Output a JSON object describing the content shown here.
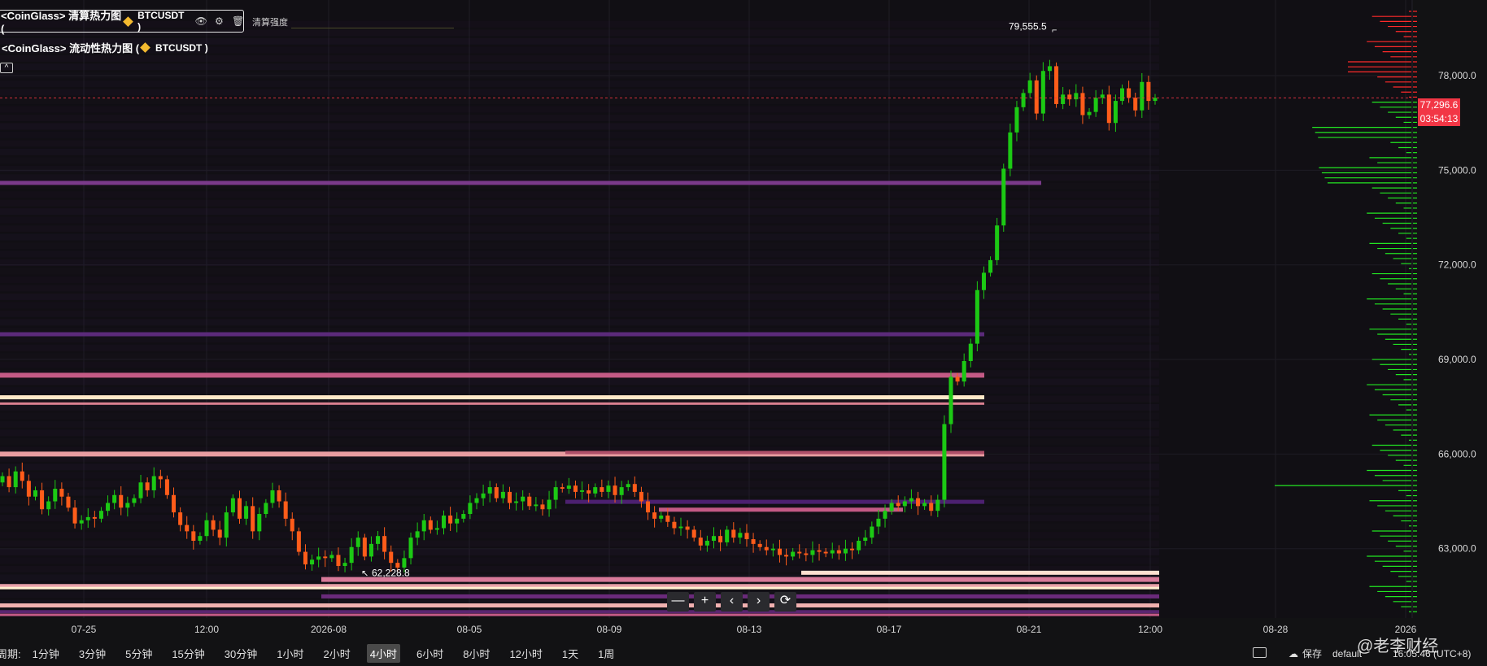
{
  "indicators": {
    "liquidation": {
      "title": "<CoinGlass> 清算热力图 (",
      "symbol": "BTCUSDT )",
      "intensity_label": "清算强度"
    },
    "liquidity": {
      "title": "<CoinGlass> 流动性热力图 (",
      "symbol": "BTCUSDT )"
    },
    "collapse_glyph": "^"
  },
  "nav": {
    "zoom_out": "—",
    "zoom_in": "+",
    "scroll_left": "‹",
    "scroll_right": "›",
    "reset": "⟳"
  },
  "timeframe": {
    "label": "周期:",
    "options": [
      "1分钟",
      "3分钟",
      "5分钟",
      "15分钟",
      "30分钟",
      "1小时",
      "2小时",
      "4小时",
      "6小时",
      "8小时",
      "12小时",
      "1天",
      "1周"
    ],
    "active": "4小时"
  },
  "footer": {
    "save_label": "保存",
    "layout_name": "default",
    "clock": "16:05:46 (UTC+8)",
    "watermark": "@老李财经"
  },
  "price_tags": {
    "last_price": "77,296.6",
    "countdown": "03:54:13"
  },
  "colors": {
    "bull": "#1cc914",
    "bear": "#ff5c1a",
    "last_price": "#f23645",
    "heat_low": "#5a2670",
    "heat_mid": "#c45a86",
    "heat_high": "#fff2c8"
  },
  "chart_data": {
    "type": "candlestick",
    "instrument": "BTCUSDT",
    "interval": "4h",
    "y_axis": {
      "min": 60800,
      "max": 80400,
      "ticks": [
        63000,
        66000,
        69000,
        72000,
        75000,
        78000
      ],
      "tick_labels": [
        "63,000.0",
        "66,000.0",
        "69,000.0",
        "72,000.0",
        "75,000.0",
        "78,000.0"
      ]
    },
    "x_axis": {
      "ticks": [
        "07-25",
        "12:00",
        "2026-08",
        "08-05",
        "08-09",
        "08-13",
        "08-17",
        "08-21",
        "12:00",
        "08-28",
        "2026"
      ]
    },
    "annotations": {
      "high_label": "79,555.5",
      "high_value": 79555.5,
      "low_label": "62,228.8",
      "low_value": 62228.8
    },
    "last_price": 77296.6,
    "closes": [
      65300,
      64950,
      65450,
      65150,
      64650,
      64850,
      64250,
      64500,
      64900,
      64650,
      64300,
      63800,
      63900,
      64000,
      63950,
      64200,
      64450,
      64700,
      64300,
      64450,
      64600,
      65100,
      64850,
      65300,
      65200,
      64700,
      64150,
      63750,
      63550,
      63250,
      63400,
      63900,
      63600,
      63350,
      64150,
      64600,
      63950,
      64350,
      63550,
      64100,
      64450,
      64850,
      64500,
      63950,
      63550,
      62900,
      62500,
      62650,
      62750,
      62700,
      62800,
      62450,
      62550,
      63050,
      63350,
      62750,
      63150,
      63400,
      62900,
      62550,
      62400,
      62700,
      63350,
      63550,
      63900,
      63600,
      63650,
      64050,
      63800,
      63950,
      64100,
      64450,
      64600,
      64750,
      64950,
      64600,
      64800,
      64450,
      64500,
      64650,
      64350,
      64400,
      64250,
      64550,
      64950,
      64900,
      65000,
      64800,
      64850,
      64750,
      64950,
      64800,
      65000,
      64700,
      64950,
      65050,
      64800,
      64500,
      64150,
      63950,
      64050,
      63850,
      63650,
      63700,
      63600,
      63350,
      63100,
      63250,
      63400,
      63200,
      63600,
      63350,
      63500,
      63300,
      63150,
      63050,
      62950,
      63000,
      62800,
      62750,
      62900,
      62850,
      62800,
      62950,
      62900,
      62850,
      62950,
      62850,
      63000,
      62950,
      63250,
      63350,
      63700,
      63950,
      64200,
      64450,
      64350,
      64500,
      64600,
      64350,
      64450,
      64200,
      64550,
      66950,
      68450,
      68300,
      68950,
      69500,
      71200,
      71750,
      72150,
      73250,
      75050,
      76200,
      77000,
      77450,
      77850,
      76800,
      78150,
      78300,
      77100,
      77400,
      77250,
      77450,
      76750,
      76850,
      77300,
      77400,
      76500,
      77200,
      77600,
      77300,
      76900,
      77800,
      77200,
      77296.6
    ]
  }
}
